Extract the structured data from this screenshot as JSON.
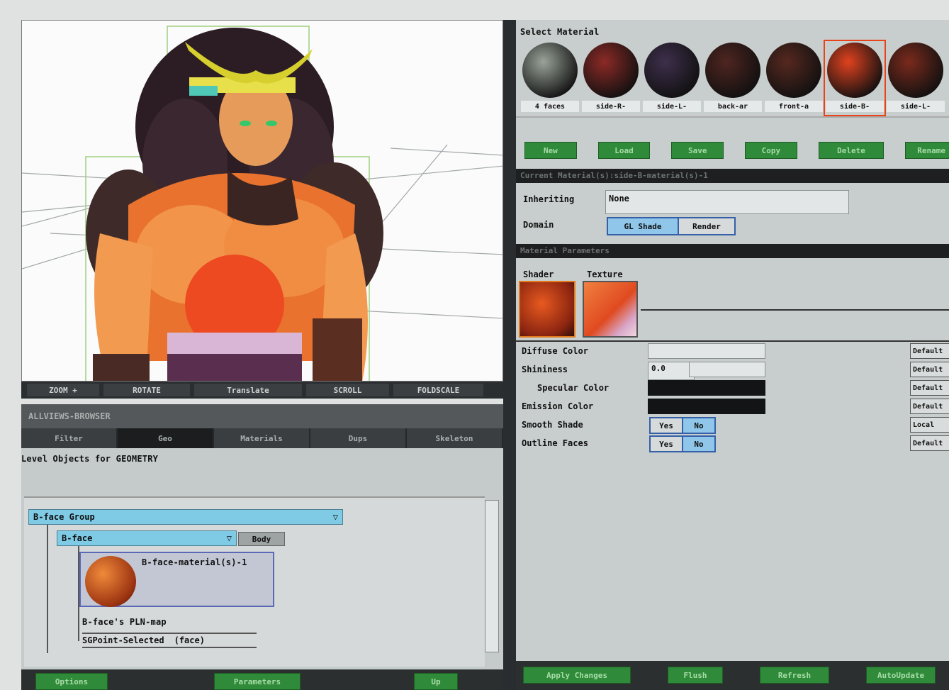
{
  "viewport": {
    "toolbar": [
      "ZOOM +",
      "ROTATE",
      "Translate",
      "SCROLL",
      "FOLDSCALE"
    ]
  },
  "lower_left": {
    "title": "ALLVIEWS-BROWSER",
    "tabs": [
      "Filter",
      "Geo",
      "Materials",
      "Dups",
      "Skeleton"
    ],
    "status": "Level Objects for GEOMETRY",
    "tree": {
      "group": "B-face Group",
      "node": "B-face",
      "node_tag": "Body",
      "material": "B-face-material(s)-1",
      "map": "B-face's PLN-map",
      "selection": "SGPoint-Selected",
      "selection_suffix": "(face)"
    },
    "buttons": [
      "Options",
      "Parameters",
      "Up"
    ]
  },
  "right": {
    "select_label": "Select Material",
    "materials": [
      {
        "caption": "4 faces",
        "color": "#9aa39a"
      },
      {
        "caption": "side-R-",
        "color": "#8c2a26"
      },
      {
        "caption": "side-L-",
        "color": "#3e2f4c"
      },
      {
        "caption": "back-ar",
        "color": "#4f2520"
      },
      {
        "caption": "front-a",
        "color": "#56281f"
      },
      {
        "caption": "side-B-",
        "color": "#e0421f"
      },
      {
        "caption": "side-L-",
        "color": "#7a2a1c"
      }
    ],
    "material_buttons": [
      "New",
      "Load",
      "Save",
      "Copy",
      "Delete",
      "Rename"
    ],
    "current_section": "Current Material(s):side-B-material(s)-1",
    "inheriting_label": "Inheriting",
    "inheriting_value": "None",
    "domain_label": "Domain",
    "domain_options": [
      "GL Shade",
      "Render"
    ],
    "params_section": "Material Parameters",
    "shader_label": "Shader",
    "texture_label": "Texture",
    "params": [
      {
        "label": "Diffuse Color"
      },
      {
        "label": "Shininess",
        "value": "0.0"
      },
      {
        "label": "Specular Color"
      },
      {
        "label": "Emission Color"
      },
      {
        "label": "Smooth Shade",
        "options": [
          "Yes",
          "No"
        ]
      },
      {
        "label": "Outline Faces",
        "options": [
          "Yes",
          "No"
        ]
      }
    ],
    "default_buttons": [
      "Default",
      "Default",
      "Default",
      "Default",
      "Local",
      "Default"
    ],
    "bottom_buttons": [
      "Apply Changes",
      "Flush",
      "Refresh",
      "AutoUpdate"
    ]
  }
}
